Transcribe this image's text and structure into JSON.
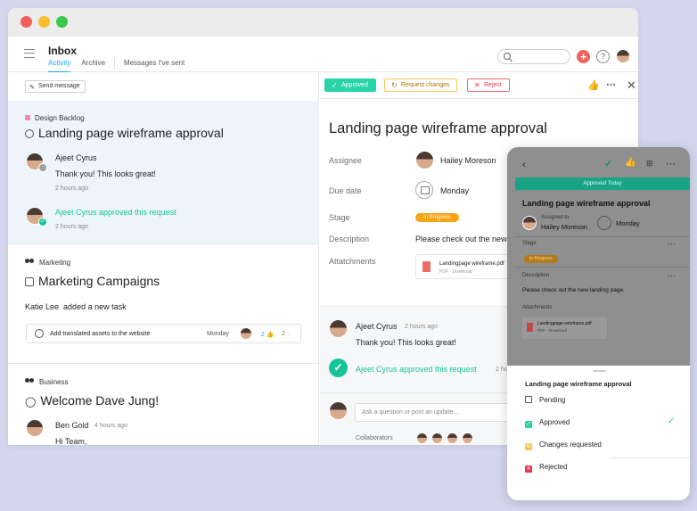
{
  "inbox": {
    "title": "Inbox",
    "tabs": [
      "Activity",
      "Archive",
      "Messages I've sent"
    ],
    "send_message": "Send message",
    "feed": [
      {
        "project": "Design Backlog",
        "task": "Landing page wireframe approval",
        "author": "Ajeet Cyrus",
        "comment": "Thank you! This looks great!",
        "time": "2 hours ago",
        "event": "Ajeet Cyrus approved this request",
        "event_time": "2 hours ago"
      },
      {
        "project": "Marketing",
        "task": "Marketing Campaigns",
        "author": "Katie Lee",
        "action": "added a new task",
        "subtask": "Add translated assets to the website",
        "due": "Monday",
        "likes": "2",
        "comments": "2"
      },
      {
        "project": "Business",
        "task": "Welcome Dave Jung!",
        "author": "Ben Gold",
        "time": "4 hours ago",
        "comment": "Hi Team,"
      }
    ]
  },
  "detail": {
    "actions": {
      "approved": "Approved",
      "request_changes": "Request changes",
      "reject": "Reject"
    },
    "title": "Landing page wireframe approval",
    "fields": {
      "assignee_label": "Assignee",
      "assignee": "Hailey Moreson",
      "due_label": "Due date",
      "due": "Monday",
      "stage_label": "Stage",
      "stage": "In Progress",
      "description_label": "Description",
      "description": "Please check out the new",
      "attachments_label": "Attatchments",
      "attachment_name": "Landingpage wireframe.pdf",
      "attachment_sub": "PDF · Download"
    },
    "comment": {
      "author": "Ajeet Cyrus",
      "time": "2 hours ago",
      "text": "Thank you! This looks great!"
    },
    "event": {
      "text": "Ajeet Cyrus approved this request",
      "time": "2 hours ago"
    },
    "composer_placeholder": "Ask a question or post an update...",
    "collaborators_label": "Collaborators"
  },
  "mobile": {
    "banner": "Approved Today",
    "title": "Landing page wireframe approval",
    "assigned_label": "Assigned to",
    "assignee": "Hailey Moreson",
    "due": "Monday",
    "stage_label": "Stage",
    "stage": "In Progress",
    "description_label": "Description",
    "description": "Please check out the new landing page.",
    "attachments_label": "Attachments",
    "attachment_name": "Landingpage wireframe.pdf",
    "attachment_sub": "PDF · Download",
    "sheet_title": "Landing page wireframe approval",
    "options": [
      "Pending",
      "Approved",
      "Changes requested",
      "Rejected"
    ]
  },
  "colors": {
    "approved": "#2bd4a8",
    "request": "#f7c85c",
    "reject": "#f06a6a",
    "accent": "#14aaf5",
    "stage": "#f8a316"
  }
}
